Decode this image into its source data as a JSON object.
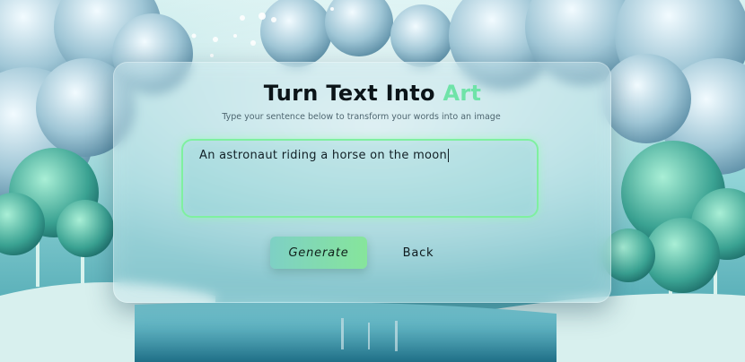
{
  "header": {
    "title_main": "Turn Text Into ",
    "title_accent": "Art",
    "subtitle": "Type your sentence below to transform your words into an image"
  },
  "prompt": {
    "value": "An astronaut riding a horse on the moon"
  },
  "actions": {
    "generate_label": "Generate",
    "back_label": "Back"
  },
  "colors": {
    "accent": "#6fe3a8",
    "prompt_border": "#7ff0a0",
    "button_gradient_start": "#7ed0c5",
    "button_gradient_end": "#86e59b"
  }
}
